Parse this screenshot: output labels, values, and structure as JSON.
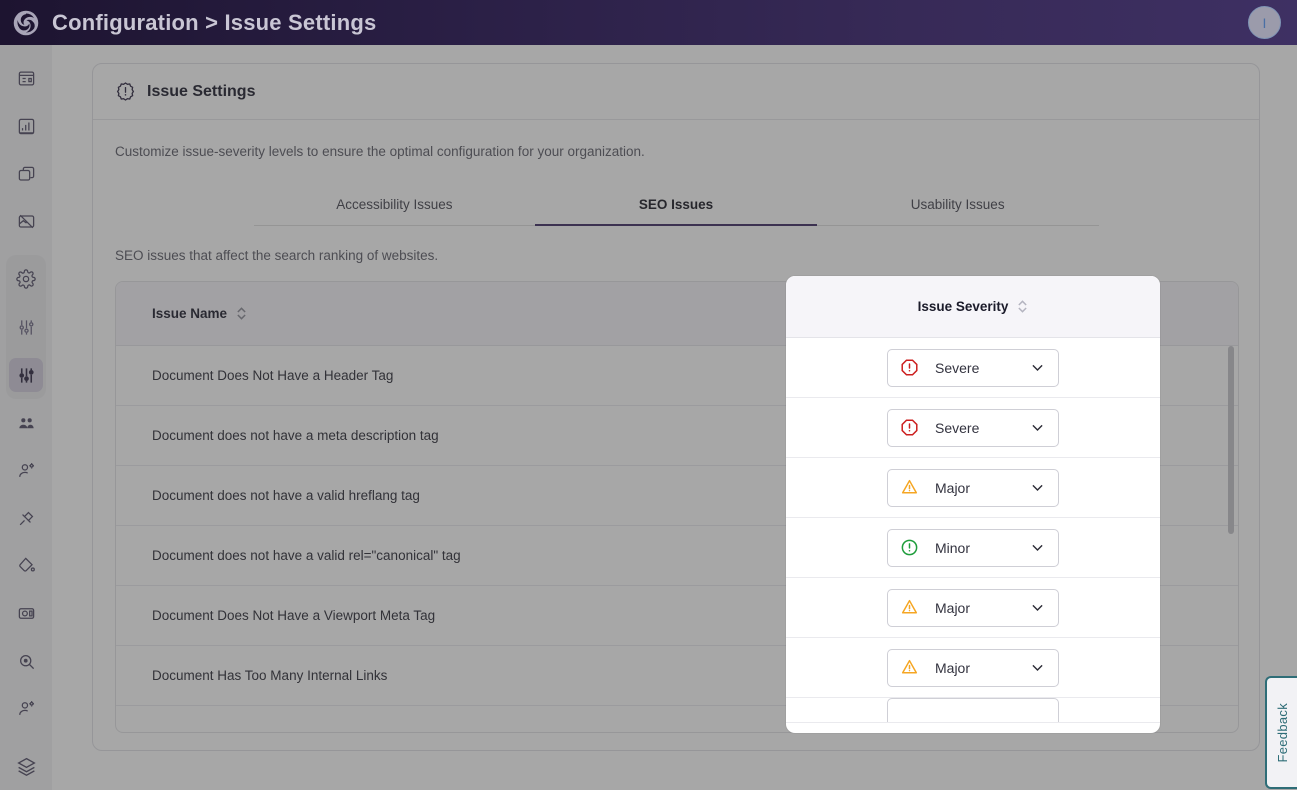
{
  "topbar": {
    "logo_icon": "spiral-logo-icon",
    "breadcrumb": "Configuration > Issue Settings",
    "avatar_initial": "I",
    "avatar_icon": "avatar"
  },
  "sidebar": {
    "items": [
      {
        "icon": "dashboard-icon",
        "label": "Dashboard"
      },
      {
        "icon": "report-chart-icon",
        "label": "Reports"
      },
      {
        "icon": "windows-stack-icon",
        "label": "Pages"
      },
      {
        "icon": "image-off-icon",
        "label": "Excluded"
      },
      {
        "icon": "gear-icon",
        "label": "Settings"
      },
      {
        "icon": "sliders-icon",
        "label": "Preferences"
      },
      {
        "icon": "sliders-filled-icon",
        "label": "Issue Settings",
        "active": true
      },
      {
        "icon": "users-icon",
        "label": "Users"
      },
      {
        "icon": "user-settings-icon",
        "label": "User Settings"
      },
      {
        "icon": "plug-icon",
        "label": "Integrations"
      },
      {
        "icon": "paint-bucket-icon",
        "label": "Theme"
      },
      {
        "icon": "camera-icon",
        "label": "Capture"
      },
      {
        "icon": "search-zoom-icon",
        "label": "Scan"
      },
      {
        "icon": "user-add-icon",
        "label": "Invite"
      },
      {
        "icon": "layers-icon",
        "label": "Layers"
      }
    ]
  },
  "card": {
    "title": "Issue Settings",
    "title_icon": "issue-badge-icon",
    "subtitle": "Customize issue-severity levels to ensure the optimal configuration for your organization."
  },
  "tabs": [
    {
      "label": "Accessibility Issues",
      "active": false
    },
    {
      "label": "SEO Issues",
      "active": true
    },
    {
      "label": "Usability Issues",
      "active": false
    }
  ],
  "tab_description": "SEO issues that affect the search ranking of websites.",
  "table": {
    "columns": {
      "issue_name": "Issue Name",
      "issue_severity": "Issue Severity",
      "sort_icon": "sort-arrows-icon"
    },
    "rows": [
      {
        "name": "Document Does Not Have a Header Tag",
        "severity": "Severe",
        "severity_icon": "octagon-alert-icon"
      },
      {
        "name": "Document does not have a meta description tag",
        "severity": "Severe",
        "severity_icon": "octagon-alert-icon"
      },
      {
        "name": "Document does not have a valid hreflang tag",
        "severity": "Major",
        "severity_icon": "triangle-alert-icon"
      },
      {
        "name": "Document does not have a valid rel=\"canonical\" tag",
        "severity": "Minor",
        "severity_icon": "circle-alert-icon"
      },
      {
        "name": "Document Does Not Have a Viewport Meta Tag",
        "severity": "Major",
        "severity_icon": "triangle-alert-icon"
      },
      {
        "name": "Document Has Too Many Internal Links",
        "severity": "Major",
        "severity_icon": "triangle-alert-icon"
      }
    ],
    "dropdown_icon": "chevron-down-icon"
  },
  "feedback": {
    "label": "Feedback"
  },
  "colors": {
    "brand_purple": "#3c2a63",
    "topbar_start": "#1d1430",
    "topbar_end": "#3e3063",
    "severe_red": "#cc1f1f",
    "major_orange": "#f5a623",
    "minor_green": "#1f9d3c",
    "feedback_teal": "#2e6d77",
    "header_bg": "#f6f5f9"
  }
}
